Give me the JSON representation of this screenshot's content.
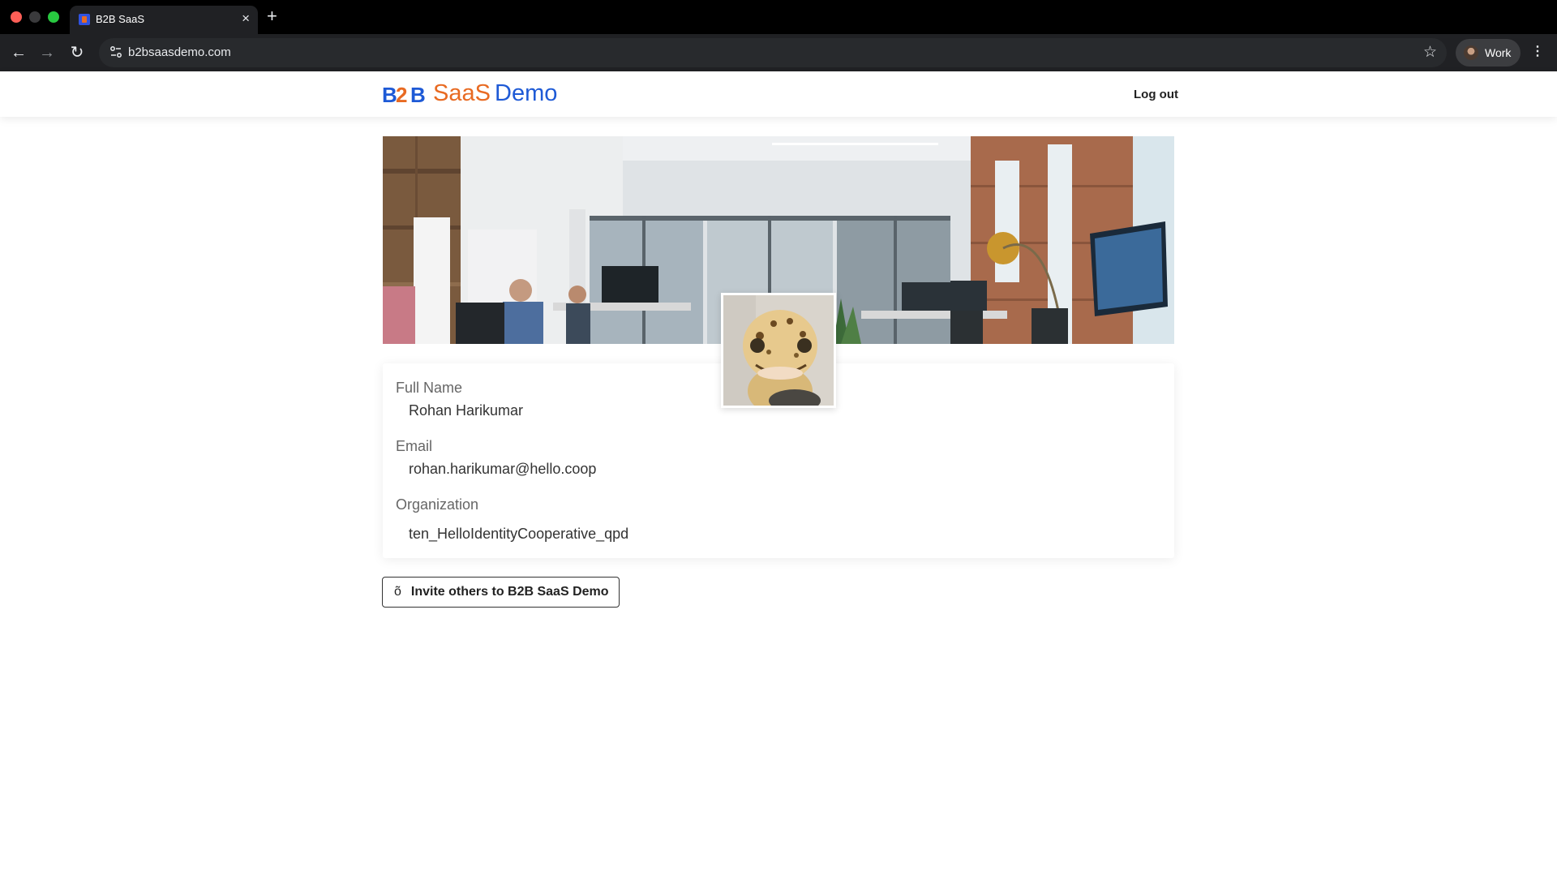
{
  "browser": {
    "tab_title": "B2B SaaS",
    "url": "b2bsaasdemo.com",
    "profile_name": "Work",
    "icons": {
      "back": "arrow-left-icon",
      "forward": "arrow-right-icon",
      "reload": "reload-icon",
      "site_info": "tune-icon",
      "bookmark": "star-icon",
      "menu": "more-vertical-icon",
      "new_tab": "plus-icon",
      "close_tab": "close-icon"
    }
  },
  "header": {
    "brand_saas": "SaaS",
    "brand_demo": "Demo",
    "logout_label": "Log out",
    "colors": {
      "brand_orange": "#e86a22",
      "brand_blue": "#1e5ad6"
    }
  },
  "profile": {
    "fields": [
      {
        "label": "Full Name",
        "value": "Rohan Harikumar"
      },
      {
        "label": "Email",
        "value": "rohan.harikumar@hello.coop"
      },
      {
        "label": "Organization",
        "value": "ten_HelloIdentityCooperative_qpd"
      }
    ]
  },
  "actions": {
    "invite_icon": "õ",
    "invite_label": "Invite others to B2B SaaS Demo"
  }
}
